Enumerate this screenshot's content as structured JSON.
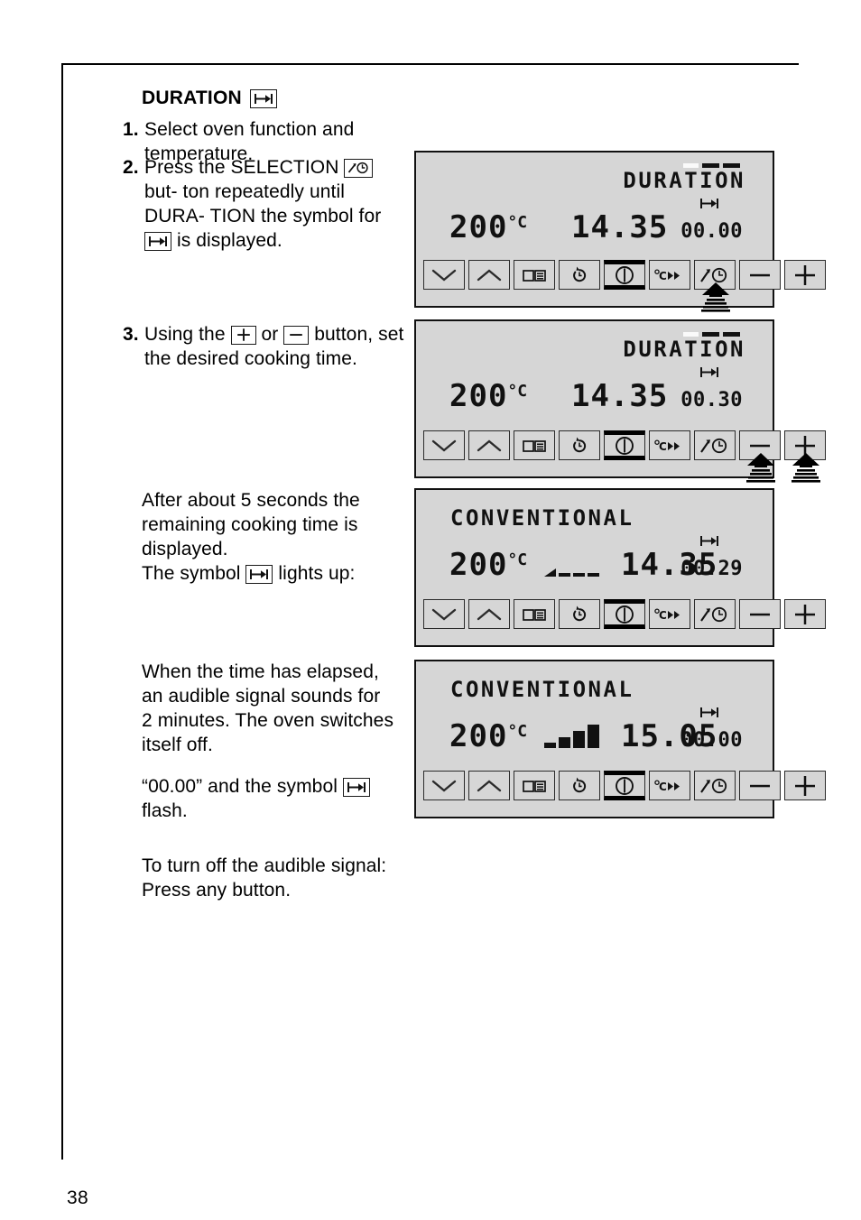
{
  "page": {
    "number": "38"
  },
  "heading": {
    "title": "DURATION",
    "symbol_icon": "duration-icon"
  },
  "steps": [
    {
      "num": "1.",
      "text": "Select oven function and temperature."
    },
    {
      "num": "2.",
      "text_a": "Press the SELECTION",
      "text_b": "but-",
      "text_c": "ton repeatedly until DURA-",
      "text_d": "TION the symbol for",
      "text_e": "is",
      "text_f": "displayed.",
      "selection_icon": "selection-icon",
      "duration_icon": "duration-icon"
    },
    {
      "num": "3.",
      "text_a": "Using the",
      "text_b": "or",
      "text_c": "button,",
      "text_d": "set the desired cooking time.",
      "plus_icon": "plus-icon",
      "minus_icon": "minus-icon"
    }
  ],
  "paragraphs": {
    "after_5s_line1": "After about 5 seconds the",
    "after_5s_line2": "remaining cooking time is",
    "after_5s_line3": "displayed.",
    "symbol_line_a": "The symbol",
    "symbol_line_b": "lights up:",
    "elapsed_line1": "When the time has elapsed,",
    "elapsed_line2": "an audible signal sounds for",
    "elapsed_line3": "2 minutes. The oven switches",
    "elapsed_line4": "itself off.",
    "flash_line_a": "“00.00” and the symbol",
    "flash_line_b": "flash.",
    "turnoff_line1": "To turn off the audible signal:",
    "turnoff_line2": "Press any button."
  },
  "displays": [
    {
      "id": "display-1",
      "mode_text": "DURATION",
      "mode_align": "right",
      "mode_flashing": true,
      "duration_symbol": "duration-icon",
      "temperature": "200",
      "temperature_unit": "°C",
      "clock": "14.35",
      "timer": "00.00",
      "heat_level": 0,
      "heat_visible": false,
      "highlight_button": "selection",
      "press_indicators": [
        "selection"
      ]
    },
    {
      "id": "display-2",
      "mode_text": "DURATION",
      "mode_align": "right",
      "mode_flashing": true,
      "duration_symbol": "duration-icon",
      "temperature": "200",
      "temperature_unit": "°C",
      "clock": "14.35",
      "timer": "00.30",
      "heat_level": 0,
      "heat_visible": false,
      "highlight_button": "none",
      "press_indicators": [
        "minus",
        "plus"
      ]
    },
    {
      "id": "display-3",
      "mode_text": "CONVENTIONAL",
      "mode_align": "left",
      "mode_flashing": false,
      "duration_symbol": "duration-icon",
      "temperature": "200",
      "temperature_unit": "°C",
      "clock": "14.35",
      "timer": "00.29",
      "heat_level": 1,
      "heat_visible": true,
      "highlight_button": "none",
      "press_indicators": []
    },
    {
      "id": "display-4",
      "mode_text": "CONVENTIONAL",
      "mode_align": "left",
      "mode_flashing": false,
      "duration_symbol": "duration-icon",
      "temperature": "200",
      "temperature_unit": "°C",
      "clock": "15.05",
      "timer": "00.00",
      "heat_level": 4,
      "heat_visible": true,
      "highlight_button": "none",
      "press_indicators": []
    }
  ],
  "button_row": {
    "buttons": [
      {
        "name": "down-chevron-button",
        "icon": "chevron-down-icon"
      },
      {
        "name": "up-chevron-button",
        "icon": "chevron-up-icon"
      },
      {
        "name": "book-button",
        "icon": "book-icon"
      },
      {
        "name": "timer-button",
        "icon": "stopwatch-icon"
      },
      {
        "name": "power-button",
        "icon": "power-icon"
      },
      {
        "name": "temperature-button",
        "icon": "celsius-arrows-icon"
      },
      {
        "name": "selection-button",
        "icon": "selection-icon"
      },
      {
        "name": "minus-button",
        "icon": "minus-icon"
      },
      {
        "name": "plus-button",
        "icon": "plus-icon"
      }
    ]
  },
  "colors": {
    "lcd_background": "#d6d6d6",
    "lcd_foreground": "#111111",
    "page_text": "#000000",
    "frame_line": "#000000"
  }
}
